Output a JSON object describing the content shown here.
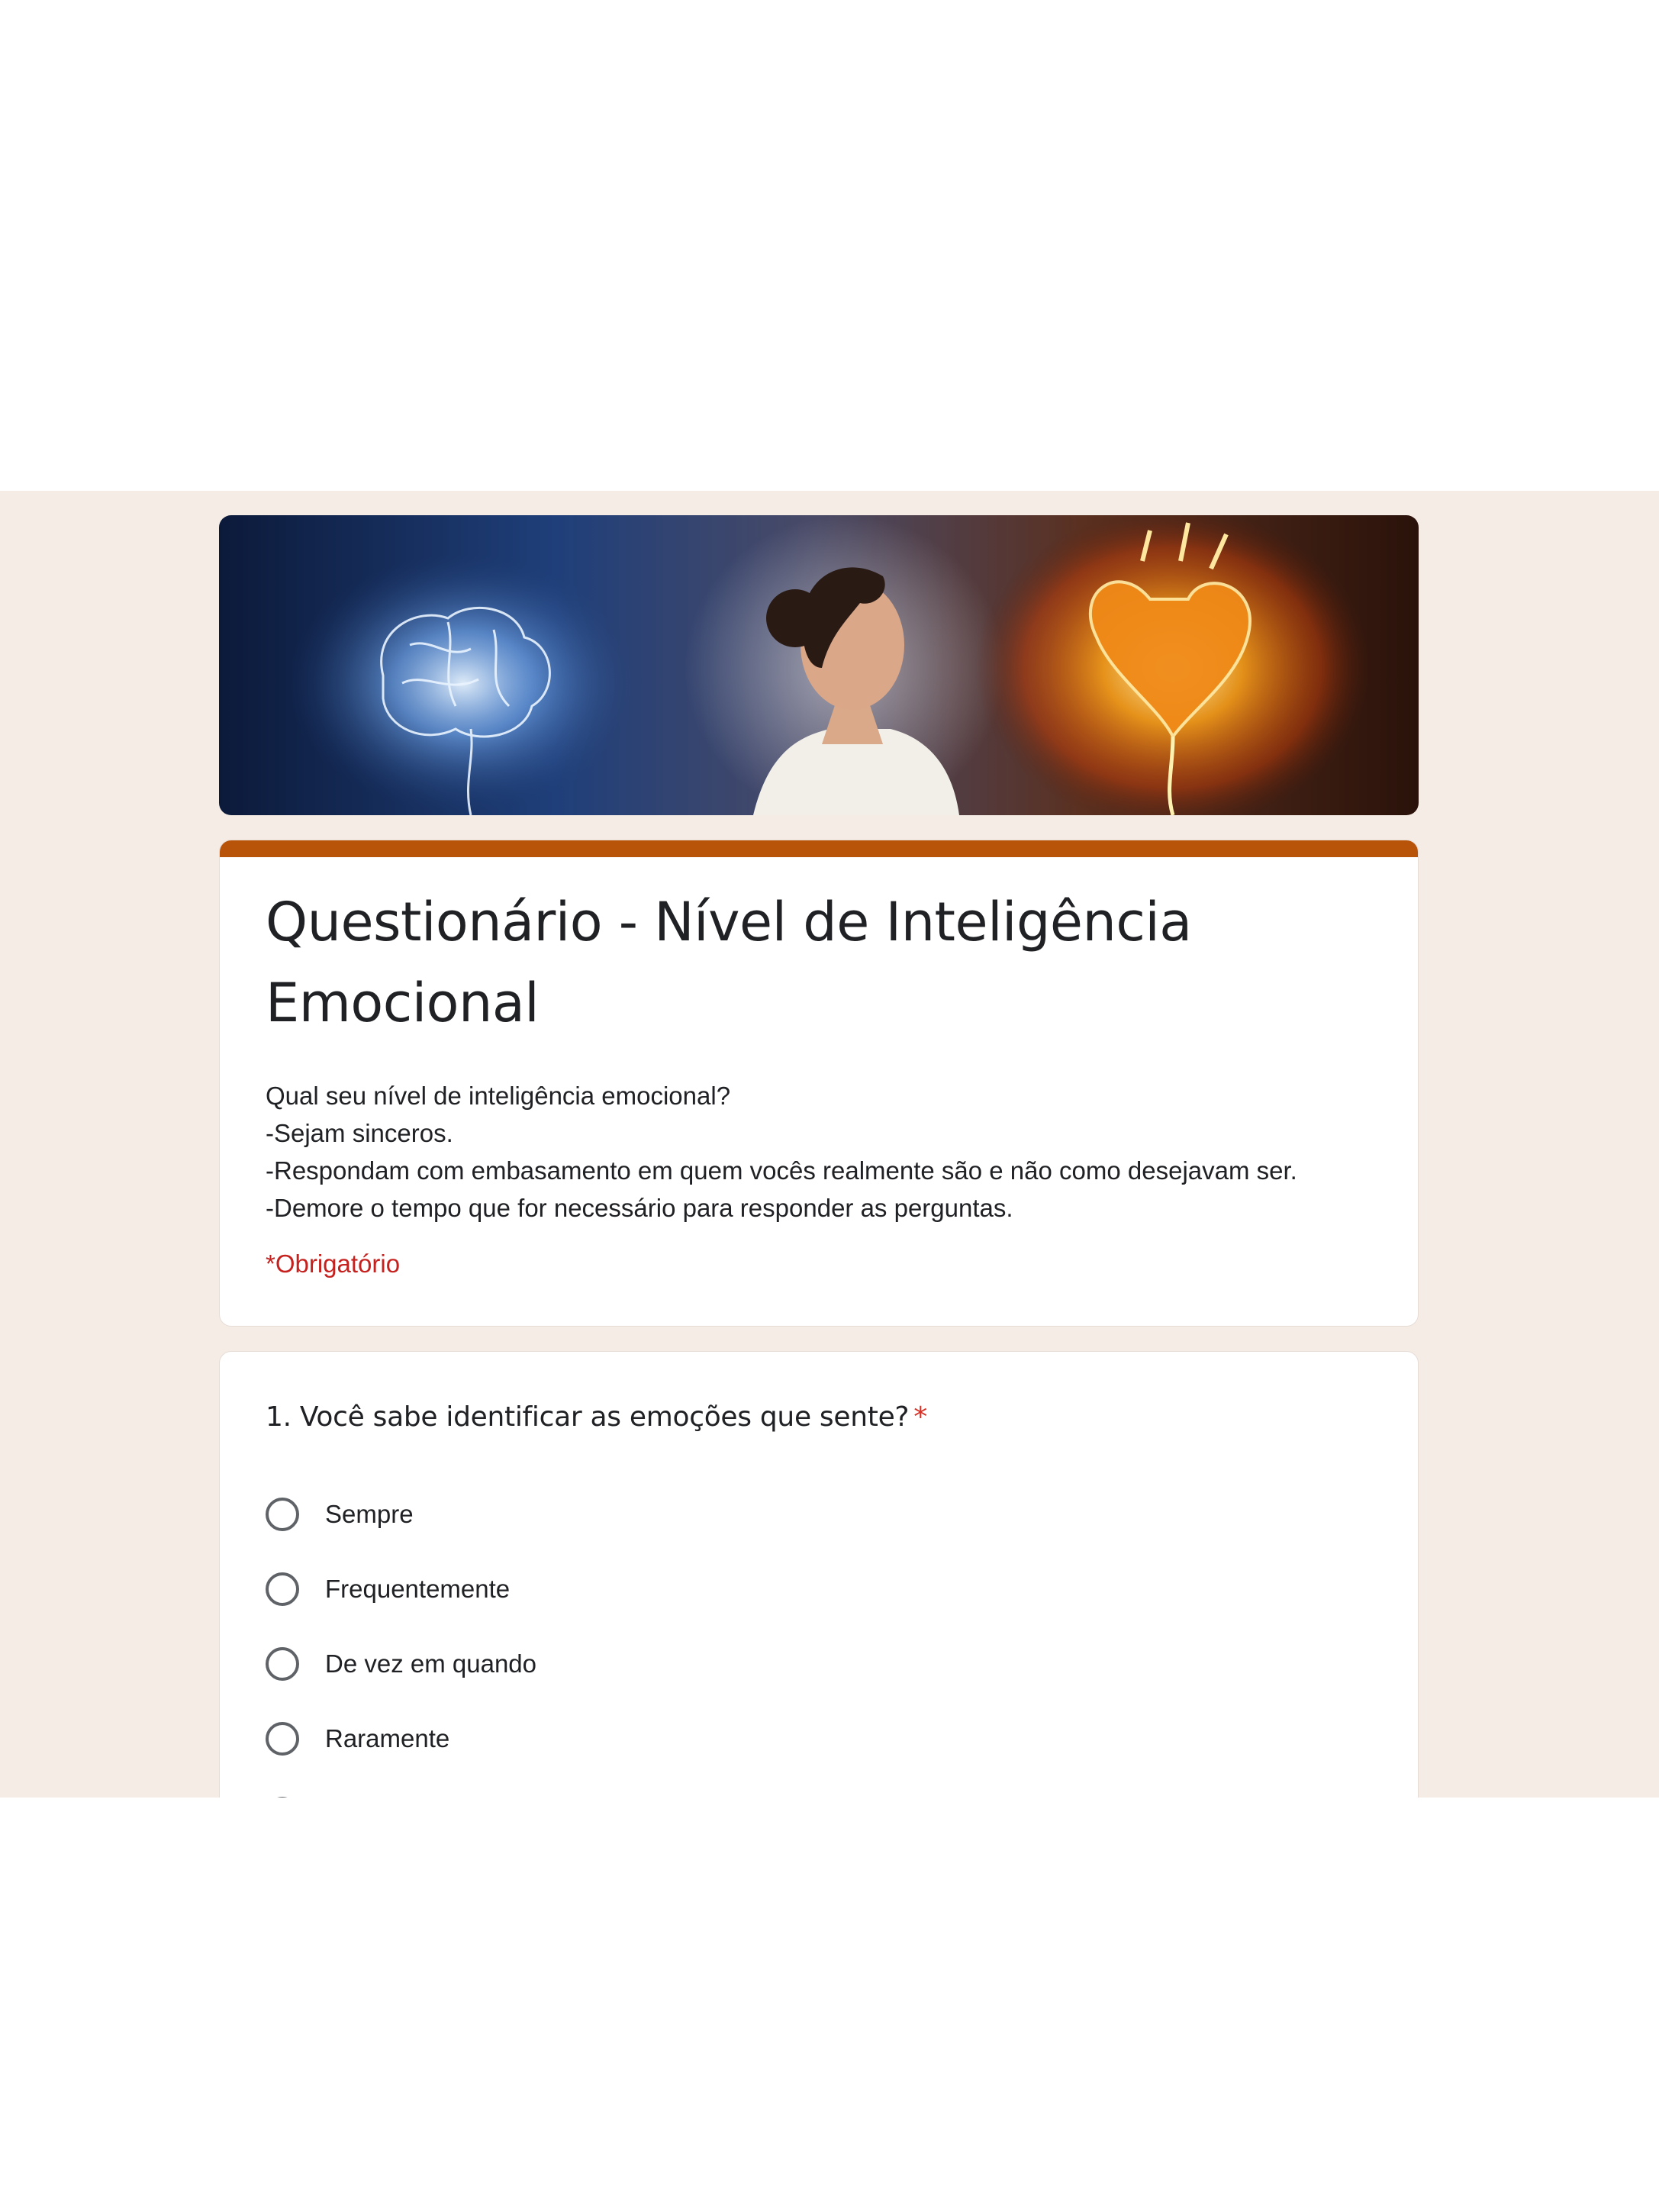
{
  "form": {
    "title": "Questionário - Nível de Inteligência Emocional",
    "description_lines": [
      "Qual seu nível de inteligência emocional?",
      "-Sejam sinceros.",
      "-Respondam com embasamento em quem vocês realmente são e não como desejavam ser.",
      "-Demore o tempo que for necessário para responder as perguntas."
    ],
    "required_note": "*Obrigatório"
  },
  "question1": {
    "title": "1. Você sabe identificar as emoções que sente?",
    "required_mark": "*",
    "options": [
      "Sempre",
      "Frequentemente",
      "De vez em quando",
      "Raramente"
    ]
  },
  "colors": {
    "accent": "#b8530a",
    "background": "#f6ece6",
    "required": "#c5221f"
  },
  "icons": {
    "banner": "brain-woman-heart-image",
    "radio": "radio-unchecked-icon"
  }
}
